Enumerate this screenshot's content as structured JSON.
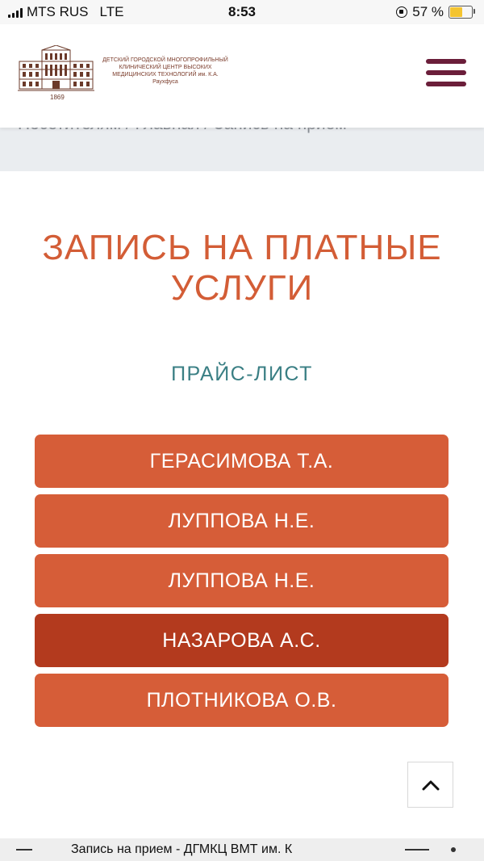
{
  "status_bar": {
    "carrier": "MTS RUS",
    "network": "LTE",
    "time": "8:53",
    "battery_percent": "57 %",
    "battery_level": 0.57,
    "battery_color": "#f4c430"
  },
  "header": {
    "logo_text": "ДЕТСКИЙ ГОРОДСКОЙ МНОГОПРОФИЛЬНЫЙ КЛИНИЧЕСКИЙ ЦЕНТР ВЫСОКИХ МЕДИЦИНСКИХ ТЕХНОЛОГИЙ им. К.А. Раухфуса",
    "logo_year": "1869",
    "menu_icon": "hamburger-icon",
    "menu_color": "#6b1e3a"
  },
  "breadcrumb": "Посетителям / Главная / Запись на прием",
  "main": {
    "title": "ЗАПИСЬ НА ПЛАТНЫЕ УСЛУГИ",
    "subtitle": "ПРАЙС-ЛИСТ",
    "doctors": [
      {
        "label": "ГЕРАСИМОВА Т.А."
      },
      {
        "label": "ЛУППОВА Н.Е."
      },
      {
        "label": "ЛУППОВА Н.Е."
      },
      {
        "label": "НАЗАРОВА А.С."
      },
      {
        "label": "ПЛОТНИКОВА О.В."
      }
    ],
    "active_index": 3,
    "colors": {
      "title": "#d35d36",
      "subtitle": "#3a7f84",
      "button": "#d65d38",
      "button_active": "#b33a1e"
    }
  },
  "scroll_top_icon": "chevron-up-icon",
  "browser_bar": {
    "page_title": "Запись на прием - ДГМКЦ ВМТ им. К"
  }
}
